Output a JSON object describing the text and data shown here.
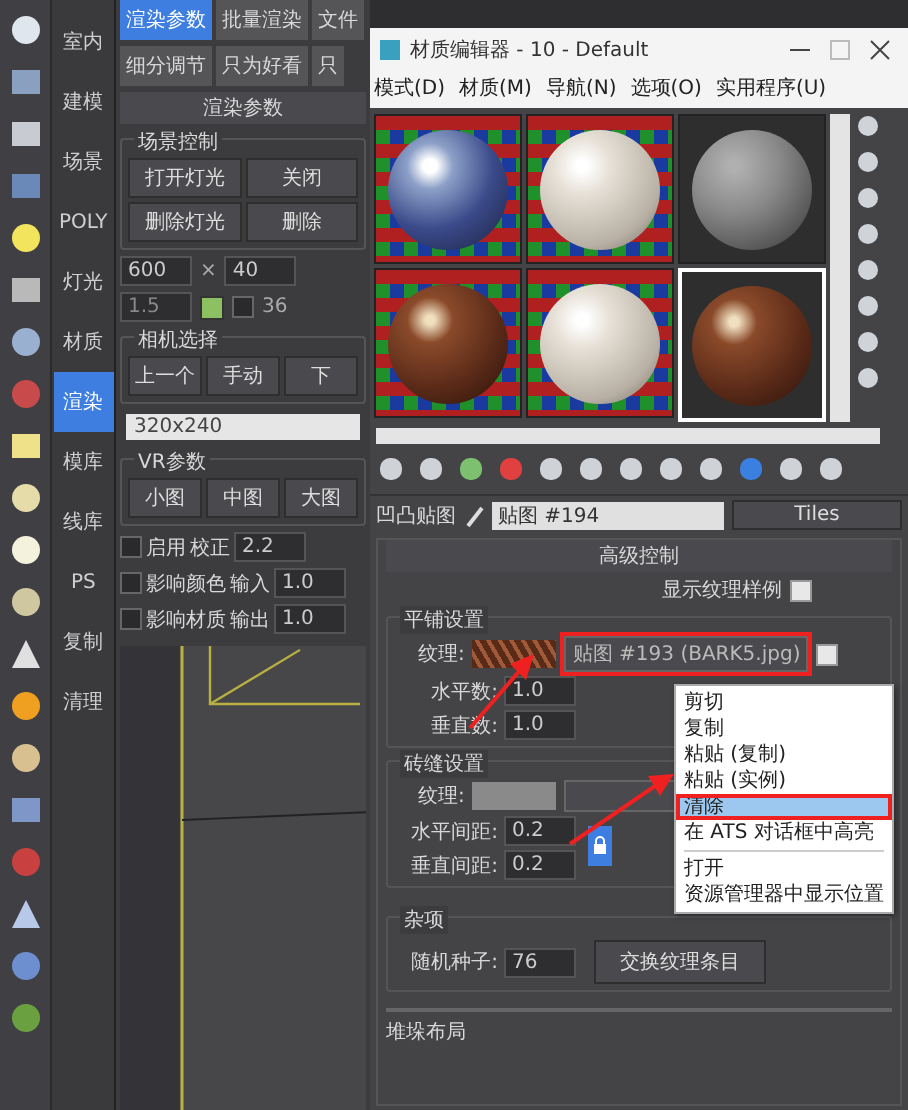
{
  "categories": [
    {
      "label": "室内",
      "selected": false
    },
    {
      "label": "建模",
      "selected": false
    },
    {
      "label": "场景",
      "selected": false
    },
    {
      "label": "POLY",
      "selected": false
    },
    {
      "label": "灯光",
      "selected": false
    },
    {
      "label": "材质",
      "selected": false
    },
    {
      "label": "渲染",
      "selected": true
    },
    {
      "label": "模库",
      "selected": false
    },
    {
      "label": "线库",
      "selected": false
    },
    {
      "label": "PS",
      "selected": false
    },
    {
      "label": "复制",
      "selected": false
    },
    {
      "label": "清理",
      "selected": false
    }
  ],
  "plugin_panel": {
    "tabs": [
      {
        "label": "渲染参数",
        "selected": true
      },
      {
        "label": "批量渲染",
        "selected": false
      },
      {
        "label": "文件",
        "selected": false
      }
    ],
    "subtabs": [
      "细分调节",
      "只为好看",
      "只"
    ],
    "rollout_title": "渲染参数",
    "scene_group": {
      "title": "场景控制",
      "buttons": [
        "打开灯光",
        "关闭",
        "删除灯光",
        "删除"
      ]
    },
    "width_value": "600",
    "times": "×",
    "height_value": "40",
    "ratio_value": "1.5",
    "option_checked": false,
    "option_label": "36",
    "camera_group": {
      "title": "相机选择",
      "buttons": [
        "上一个",
        "手动",
        "下"
      ]
    },
    "resolution": "320x240",
    "vr_group": {
      "title": "VR参数",
      "buttons": [
        "小图",
        "中图",
        "大图"
      ]
    },
    "options": [
      {
        "label": "启用",
        "checked": false,
        "field_label": "校正",
        "value": "2.2"
      },
      {
        "label": "影响颜色",
        "checked": false,
        "field_label": "输入",
        "value": "1.0"
      },
      {
        "label": "影响材质",
        "checked": false,
        "field_label": "输出",
        "value": "1.0"
      }
    ]
  },
  "material_editor": {
    "title": "材质编辑器 - 10 - Default",
    "menu": [
      "模式(D)",
      "材质(M)",
      "导航(N)",
      "选项(O)",
      "实用程序(U)"
    ],
    "slots": [
      {
        "kind": "glass",
        "checker": true,
        "selected": false
      },
      {
        "kind": "white",
        "checker": true,
        "selected": false
      },
      {
        "kind": "grey",
        "checker": false,
        "selected": false
      },
      {
        "kind": "wood",
        "checker": true,
        "selected": false
      },
      {
        "kind": "white",
        "checker": true,
        "selected": false
      },
      {
        "kind": "wood",
        "checker": false,
        "selected": true
      }
    ],
    "map_row": {
      "label": "凹凸贴图",
      "map_name": "贴图 #194",
      "type_button": "Tiles"
    },
    "rollout_title": "高级控制",
    "show_sample": {
      "label": "显示纹理样例",
      "checked": true
    },
    "tiles_group": {
      "title": "平铺设置",
      "texture_label": "纹理:",
      "map_button": "贴图 #193 (BARK5.jpg)",
      "map_annotated": true,
      "enabled": true,
      "fields": [
        {
          "label": "水平数:",
          "value": "1.0"
        },
        {
          "label": "垂直数:",
          "value": "1.0"
        }
      ]
    },
    "grout_group": {
      "title": "砖缝设置",
      "texture_label": "纹理:",
      "fields": [
        {
          "label": "水平间距:",
          "value": "0.2"
        },
        {
          "label": "垂直间距:",
          "value": "0.2"
        }
      ],
      "lock_on": true
    },
    "misc_group": {
      "title": "杂项",
      "seed_label": "随机种子:",
      "seed_value": "76",
      "swap_button": "交换纹理条目"
    },
    "next_rollout": "堆垛布局",
    "context_menu": {
      "groups": [
        [
          {
            "label": "剪切",
            "selected": false,
            "annotated": false
          },
          {
            "label": "复制",
            "selected": false,
            "annotated": false
          },
          {
            "label": "粘贴 (复制)",
            "selected": false,
            "annotated": false
          },
          {
            "label": "粘贴 (实例)",
            "selected": false,
            "annotated": false
          },
          {
            "label": "清除",
            "selected": true,
            "annotated": true
          },
          {
            "label": "在 ATS 对话框中高亮",
            "selected": false,
            "annotated": false
          }
        ],
        [
          {
            "label": "打开",
            "selected": false,
            "annotated": false
          },
          {
            "label": "资源管理器中显示位置",
            "selected": false,
            "annotated": false
          }
        ]
      ]
    }
  }
}
